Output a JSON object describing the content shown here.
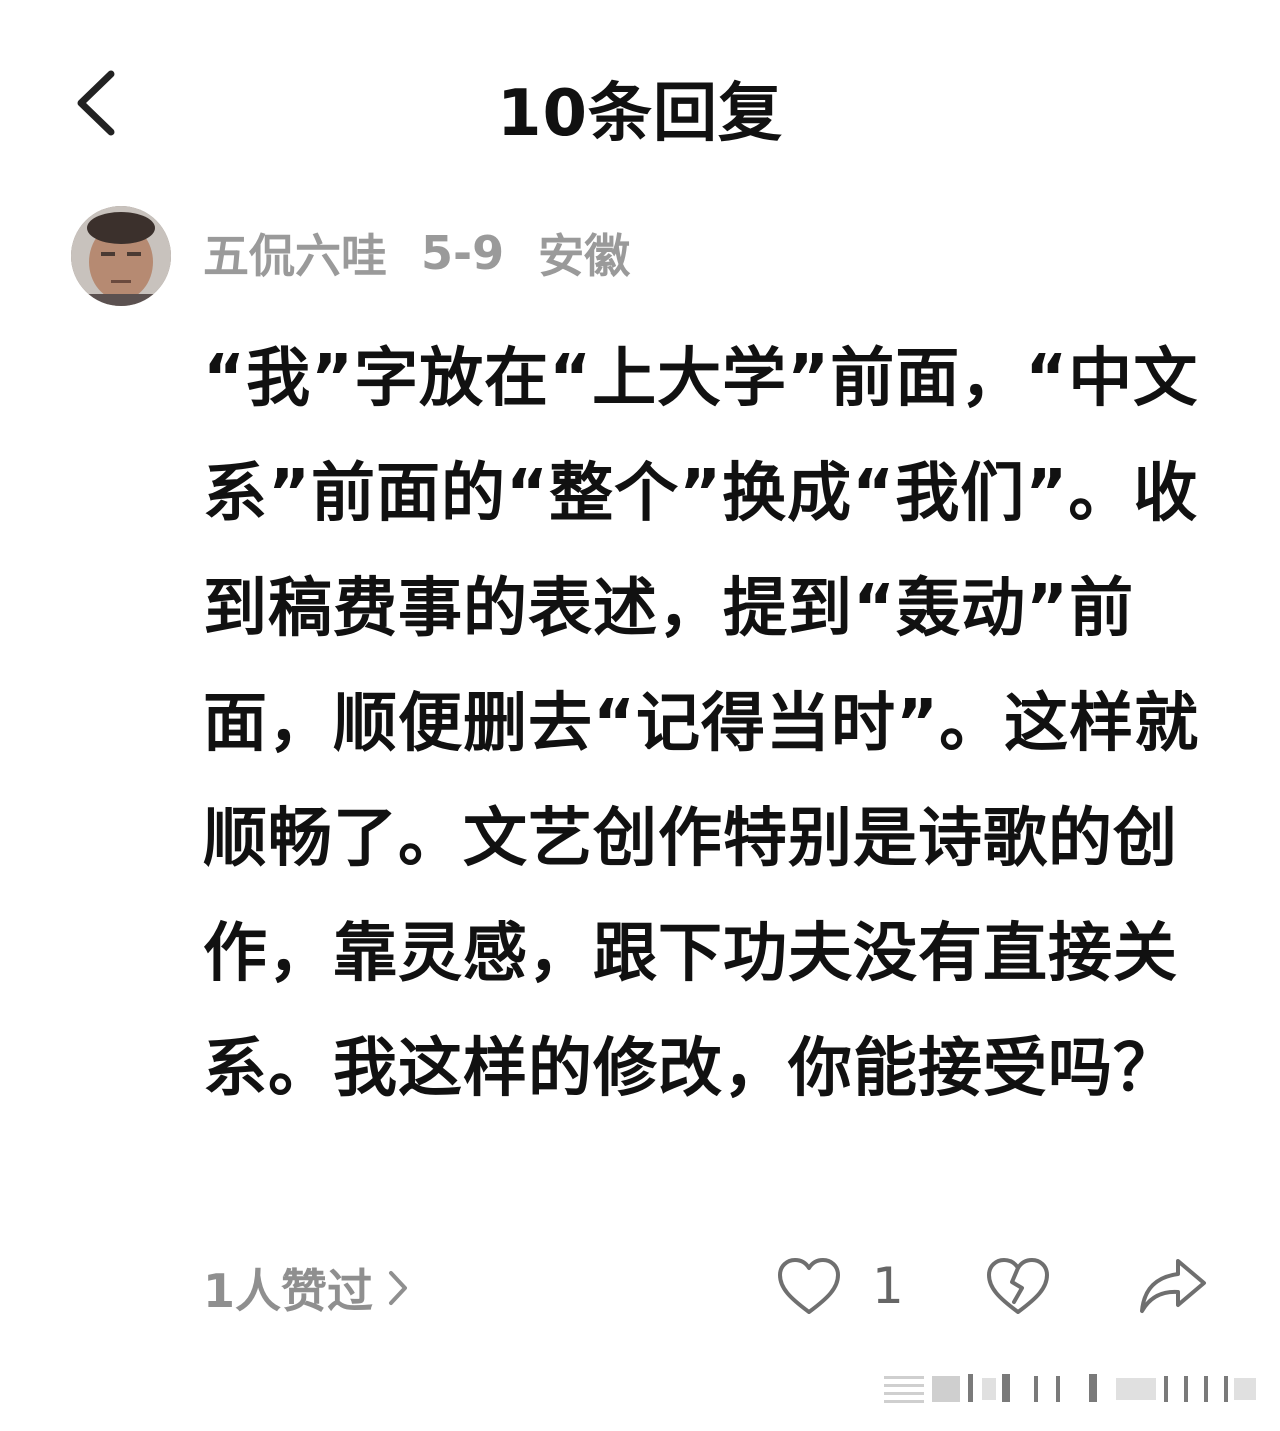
{
  "header": {
    "title": "10条回复"
  },
  "comment": {
    "author": "五侃六哇",
    "date": "5-9",
    "location": "安徽",
    "avatar_icon": "user-avatar",
    "text": "“我”字放在“上大学”前面，“中文系”前面的“整个”换成“我们”。收到稿费事的表述，提到“轰动”前面，顺便删去“记得当时”。这样就顺畅了。文艺创作特别是诗歌的创作，靠灵感，跟下功夫没有直接关系。我这样的修改，你能接受吗？"
  },
  "footer": {
    "likes_summary": "1人赞过",
    "like_count": "1",
    "icons": {
      "like": "heart-outline-icon",
      "dislike": "broken-heart-icon",
      "share": "share-arrow-icon",
      "chevron": "chevron-right-icon",
      "back": "back-arrow-icon"
    }
  },
  "colors": {
    "text": "#111111",
    "meta_gray": "#9a9a9a",
    "icon_gray": "#6f6f6f",
    "background": "#ffffff"
  }
}
